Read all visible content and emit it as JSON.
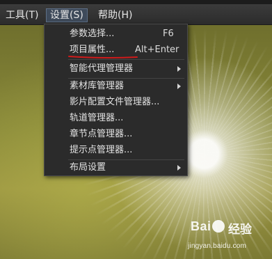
{
  "menubar": {
    "items": [
      {
        "label": "工具(T)"
      },
      {
        "label": "设置(S)"
      },
      {
        "label": "帮助(H)"
      }
    ]
  },
  "settings_menu": {
    "items": [
      {
        "label": "参数选择...",
        "shortcut": "F6"
      },
      {
        "label": "项目属性...",
        "shortcut": "Alt+Enter"
      },
      {
        "label": "智能代理管理器"
      },
      {
        "label": "素材库管理器"
      },
      {
        "label": "影片配置文件管理器..."
      },
      {
        "label": "轨道管理器..."
      },
      {
        "label": "章节点管理器..."
      },
      {
        "label": "提示点管理器..."
      },
      {
        "label": "布局设置"
      }
    ]
  },
  "watermark": {
    "logo": "Bai",
    "brand": "经验",
    "url": "jingyan.baidu.com"
  },
  "colors": {
    "highlight_underline": "#d01a1a",
    "menu_background": "#2b2b2b",
    "active_menubar": "#3e4a5a"
  }
}
